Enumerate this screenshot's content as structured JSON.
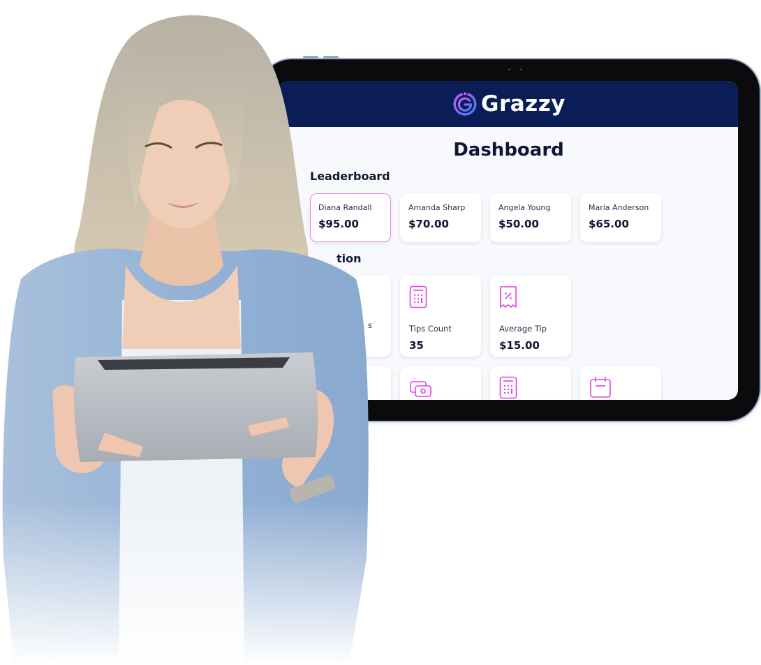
{
  "app": {
    "brand": "Grazzy",
    "brand_color": "#0b1d57",
    "accent_color": "#e040e0"
  },
  "dashboard": {
    "title": "Dashboard",
    "leaderboard": {
      "title": "Leaderboard",
      "entries": [
        {
          "name": "Diana Randall",
          "amount": "$95.00",
          "highlighted": true
        },
        {
          "name": "Amanda Sharp",
          "amount": "$70.00",
          "highlighted": false
        },
        {
          "name": "Angela Young",
          "amount": "$50.00",
          "highlighted": false
        },
        {
          "name": "Maria Anderson",
          "amount": "$65.00",
          "highlighted": false
        }
      ]
    },
    "section2": {
      "title_visible_fragment": "tion",
      "stats": [
        {
          "label_visible_fragment": "s",
          "value": "",
          "icon": "obscured"
        },
        {
          "label": "Tips Count",
          "value": "35",
          "icon": "calculator-icon"
        },
        {
          "label": "Average Tip",
          "value": "$15.00",
          "icon": "receipt-percent-icon"
        }
      ],
      "second_row_icons": [
        "obscured",
        "cash-icon",
        "calculator-icon",
        "calendar-icon"
      ]
    }
  },
  "photo": {
    "subject": "woman in light blue blazer holding a silver tablet"
  }
}
